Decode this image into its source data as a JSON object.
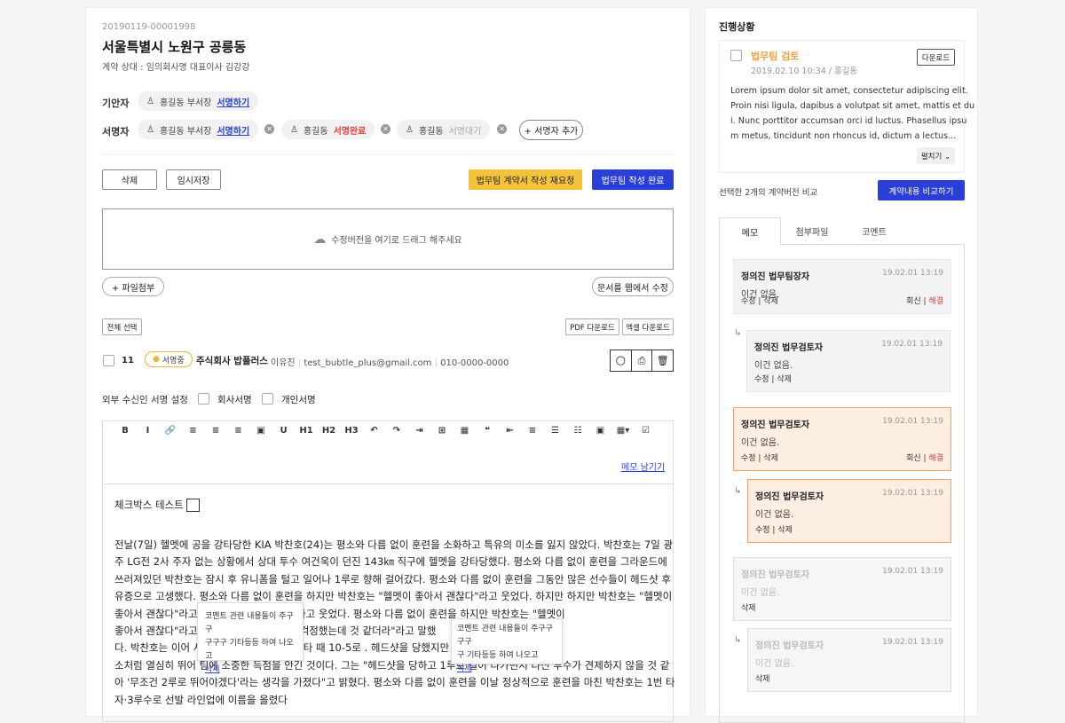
{
  "doc": {
    "id": "20190119-00001998",
    "title": "서울특별시 노원구 공릉동",
    "subtitle": "계약 상대 : 임의회사명 대표이사 김강강"
  },
  "drafter": {
    "label": "기안자",
    "person": "홍길동 부서장",
    "action": "서명하기"
  },
  "signers": {
    "label": "서명자",
    "items": [
      {
        "name": "홍길동 부서장",
        "status": "서명하기"
      },
      {
        "name": "홍길동",
        "status": "서명완료"
      },
      {
        "name": "홍길동",
        "status": "서명대기"
      }
    ],
    "add": "+ 서명자 추가"
  },
  "actions": {
    "delete": "삭제",
    "temp_save": "임시저장",
    "rerequest": "법무팀 계약서 작성 재요청",
    "complete": "법무팀 작성 완료"
  },
  "upload": {
    "text": "수정버전을 여기로 드래그 해주세요"
  },
  "attach": {
    "file": "+ 파일첨부",
    "web_edit": "문서를 웹에서 수정"
  },
  "list": {
    "select_all": "전체 선택",
    "pdf": "PDF 다운로드",
    "excel": "엑셀 다운로드"
  },
  "row": {
    "num": "11",
    "status": "서명중",
    "company": "주식회사 밥플러스",
    "person": "이유진",
    "email": "test_bubtle_plus@gmail.com",
    "phone": "010-0000-0000"
  },
  "external": {
    "label": "외부 수신인 서명 설정",
    "company": "회사서명",
    "personal": "개인서명"
  },
  "editor": {
    "toolbar": [
      "B",
      "I",
      "🔗",
      "≡",
      "≡",
      "≡",
      "▣",
      "U",
      "H1",
      "H2",
      "H3",
      "↶",
      "↷",
      "⇥",
      "⊞",
      "▦",
      "❝",
      "⇤",
      "≡",
      "☰",
      "☷",
      "▣",
      "▦▾",
      "☑"
    ],
    "memo_link": "메모 남기기",
    "check_test": "체크박스 테스트",
    "lines": [
      "전날(7일) 헬멧에 공을 강타당한 KIA 박찬호(24)는 평소와 다름 없이 훈련을 소화하고 특유의 미소를 잃지 않았다. 박찬호는 7일 광",
      "주 LG전 2사 주자 없는 상황에서 상대 투수 여건욱이 던진 143㎞ 직구에 헬멧을 강타당했다. 평소와 다름 없이 훈련을 그라운드에",
      "쓰러져있던 박찬호는 잠시 후 유니폼을 털고 일어나 1루로 향해 걸어갔다. 평소와 다름 없이 훈련을 그동안 많은 선수들이 헤드샷 후",
      "유증으로 고생했다. 평소와 다름 없이 훈련을 하지만 박찬호는 \"헬멧이 좋아서 괜찮다\"라고 웃었다. 하지만 하지만 박찬호는 \"헬멧이",
      "좋아서 괜찮다\"라고                              헬멧이 좋아서 괜찮다\"라고 웃었다. 평소와 다름 없이 훈련을 하지만 박찬호는 \"헬멧이",
      "좋아서 괜찮다\"라고                              행도 \"박찬호의 상태를 걱정했는데                         것 같더라\"라고 말했",
      "다. 박찬호는 이어 서                              고, 후속 황윤호의 적시타 때 10-5로                          . 헤드샷을 당했지만 평",
      "소처럼 열심히 뛰어 팀에 소중한 득점을 안긴 것이다. 그는 \"헤드샷을 당하고 1루로 걸어 나가면서 다신 투수가 견제하지 않을 것 같",
      "아 '무조건 2루로 뛰어야겠다'라는 생각을 가졌다\"고 밝혔다. 평소와 다름 없이 훈련을 이날 정상적으로 훈련을 마친 박찬호는 1번 타",
      "자·3루수로 선발 라인업에 이름을 올렸다"
    ],
    "popup1": {
      "text1": "코멘트 관련 내용들이 주구구",
      "text2": "구구구 기타등등 하여 나오고",
      "del": "삭제"
    },
    "popup2": {
      "text1": "코멘트 관련 내용들이 주구구구구",
      "text2": "구 기타등등 하여 나오고",
      "del": "삭제"
    }
  },
  "side": {
    "progress_title": "진행상황",
    "review": {
      "title": "법무팀 검토",
      "meta": "2019.02.10 10:34 / 홍길동",
      "download": "다운로드",
      "body": [
        "Lorem ipsum dolor sit amet, consectetur adipiscing elit.",
        "Proin nisi ligula, dapibus a volutpat sit amet, mattis et du",
        "i. Nunc porttitor accumsan orci id luctus. Phasellus ipsu",
        "m metus, tincidunt non rhoncus id, dictum a lectus..."
      ],
      "expand": "펼치기 ⌄"
    },
    "compare_text": "선택한 2개의 계약버전 비교",
    "compare_btn": "계약내용 비교하기",
    "tabs": [
      "메모",
      "첨부파일",
      "코멘트"
    ],
    "memos": [
      {
        "name": "정의진 법무팀장자",
        "date": "19.02.01 13:19",
        "text": "이건 없음.",
        "edit": "수정",
        "del": "삭제",
        "reply": "회신",
        "resolve": "해결"
      },
      {
        "name": "정의진 법무검토자",
        "date": "19.02.01 13:19",
        "text": "이건 없음.",
        "edit": "수정",
        "del": "삭제"
      },
      {
        "name": "정의진 법무검토자",
        "date": "19.02.01 13:19",
        "text": "이건 없음.",
        "edit": "수정",
        "del": "삭제",
        "reply": "회신",
        "resolve": "해결"
      },
      {
        "name": "정의진 법무검토자",
        "date": "19.02.01 13:19",
        "text": "이건 없음.",
        "edit": "수정",
        "del": "삭제"
      },
      {
        "name": "정의진 법무검토자",
        "date": "19.02.01 13:19",
        "text": "이건 없음.",
        "del": "삭제"
      },
      {
        "name": "정의진 법무검토자",
        "date": "19.02.01 13:19",
        "text": "이건 없음.",
        "del": "삭제"
      }
    ]
  },
  "colors": {
    "accent": "#2a3ed8",
    "yellow": "#f5c33b",
    "orange": "#f0a46a"
  }
}
